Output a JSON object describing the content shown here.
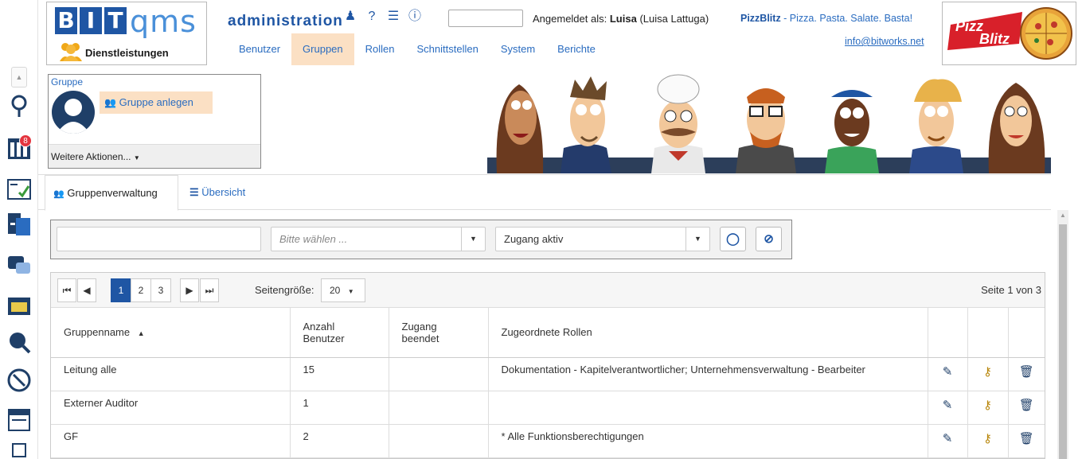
{
  "header": {
    "logo_bit": [
      "B",
      "I",
      "T"
    ],
    "logo_qms": "qms",
    "logo_sub": "Dienstleistungen",
    "admin_title": "administration",
    "login_prefix": "Angemeldet als:",
    "login_user": "Luisa",
    "login_fullname": "(Luisa Lattuga)",
    "brand_name": "PizzBlitz",
    "brand_tagline": " - Pizza. Pasta. Salate. Basta!",
    "mail": "info@bitworks.net",
    "tabs": [
      "Benutzer",
      "Gruppen",
      "Rollen",
      "Schnittstellen",
      "System",
      "Berichte"
    ],
    "active_tab": "Gruppen",
    "pizza_logo_text": [
      "Pizz",
      "Blitz"
    ]
  },
  "rail": {
    "badge_count": "8"
  },
  "group_panel": {
    "title": "Gruppe",
    "create_button": "Gruppe anlegen",
    "more_actions": "Weitere Aktionen..."
  },
  "subtabs": {
    "management": "Gruppenverwaltung",
    "overview": "Übersicht"
  },
  "filter": {
    "search_value": "",
    "select_placeholder": "Bitte wählen ...",
    "access_value": "Zugang aktiv"
  },
  "pager": {
    "pages": [
      "1",
      "2",
      "3"
    ],
    "active_page": "1",
    "page_size_label": "Seitengröße:",
    "page_size": "20",
    "page_info": "Seite 1 von 3"
  },
  "table": {
    "headers": {
      "name": "Gruppenname",
      "count_1": "Anzahl",
      "count_2": "Benutzer",
      "ended_1": "Zugang",
      "ended_2": "beendet",
      "roles": "Zugeordnete Rollen"
    },
    "rows": [
      {
        "name": "Leitung alle",
        "count": "15",
        "ended": "",
        "roles": "Dokumentation - Kapitelverantwortlicher; Unternehmensverwaltung - Bearbeiter"
      },
      {
        "name": "Externer Auditor",
        "count": "1",
        "ended": "",
        "roles": ""
      },
      {
        "name": "GF",
        "count": "2",
        "ended": "",
        "roles": "* Alle Funktionsberechtigungen"
      }
    ]
  },
  "colors": {
    "brand_blue": "#1f56a4",
    "link_blue": "#2a6cc0",
    "active_tab_bg": "#fbe0c4"
  }
}
